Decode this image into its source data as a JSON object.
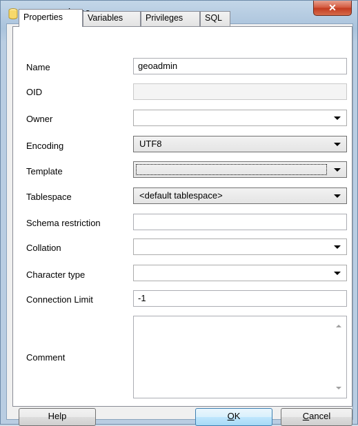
{
  "window": {
    "title": "New Database...",
    "close_label": "✕"
  },
  "tabs": [
    {
      "label": "Properties",
      "active": true
    },
    {
      "label": "Variables"
    },
    {
      "label": "Privileges"
    },
    {
      "label": "SQL"
    }
  ],
  "form": {
    "name": {
      "label": "Name",
      "value": "geoadmin"
    },
    "oid": {
      "label": "OID",
      "value": ""
    },
    "owner": {
      "label": "Owner",
      "value": ""
    },
    "encoding": {
      "label": "Encoding",
      "value": "UTF8"
    },
    "template": {
      "label": "Template",
      "value": ""
    },
    "tablespace": {
      "label": "Tablespace",
      "value": "<default tablespace>"
    },
    "schema_restriction": {
      "label": "Schema restriction",
      "value": ""
    },
    "collation": {
      "label": "Collation",
      "value": ""
    },
    "character_type": {
      "label": "Character type",
      "value": ""
    },
    "connection_limit": {
      "label": "Connection Limit",
      "value": "-1"
    },
    "comment": {
      "label": "Comment",
      "value": ""
    }
  },
  "buttons": {
    "help": "Help",
    "ok_mnemonic": "O",
    "ok_rest": "K",
    "cancel_mnemonic": "C",
    "cancel_rest": "ancel"
  },
  "colors": {
    "close_button": "#c23a1f",
    "default_button": "#bee6fd"
  },
  "icons": {
    "app": "database-cylinder-icon",
    "dropdown": "chevron-down-icon"
  }
}
